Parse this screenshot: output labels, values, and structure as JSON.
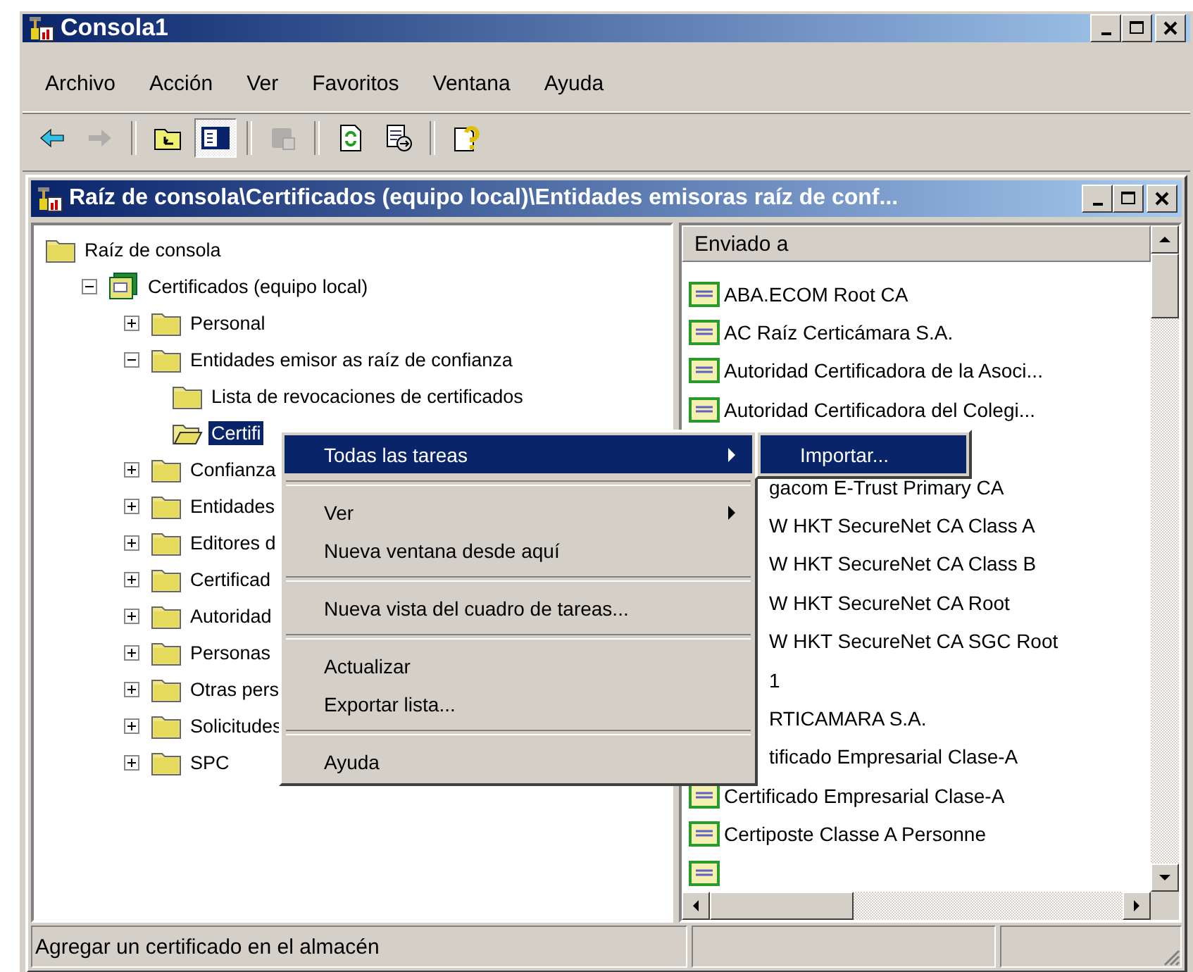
{
  "window": {
    "title": "Consola1"
  },
  "menu_bar": [
    "Archivo",
    "Acción",
    "Ver",
    "Favoritos",
    "Ventana",
    "Ayuda"
  ],
  "toolbar": [
    {
      "kind": "back",
      "pressed": false,
      "disabled": false
    },
    {
      "kind": "forward",
      "pressed": false,
      "disabled": true
    },
    {
      "kind": "sep"
    },
    {
      "kind": "up-folder",
      "pressed": false,
      "disabled": false
    },
    {
      "kind": "tree-toggle",
      "pressed": true,
      "disabled": false
    },
    {
      "kind": "sep"
    },
    {
      "kind": "new-window",
      "pressed": false,
      "disabled": true
    },
    {
      "kind": "sep"
    },
    {
      "kind": "refresh",
      "pressed": false,
      "disabled": false
    },
    {
      "kind": "export",
      "pressed": false,
      "disabled": false
    },
    {
      "kind": "sep"
    },
    {
      "kind": "help",
      "pressed": false,
      "disabled": false
    }
  ],
  "child_window": {
    "title": "Raíz de consola\\Certificados (equipo local)\\Entidades emisoras raíz de conf..."
  },
  "tree": [
    {
      "label": "Raíz de consola",
      "kind": "folder",
      "selected": false,
      "children": [
        {
          "label": "Certificados (equipo local)",
          "kind": "store",
          "expanded": true,
          "selected": false,
          "children": [
            {
              "label": "Personal",
              "kind": "folder",
              "expanded": false,
              "selected": false
            },
            {
              "label": "Entidades emisor as raíz de confianza",
              "kind": "folder",
              "expanded": true,
              "selected": false,
              "children": [
                {
                  "label": "Lista de revocaciones de certificados",
                  "kind": "folder",
                  "selected": false
                },
                {
                  "label": "Certifi",
                  "kind": "open-folder",
                  "selected": true
                }
              ]
            },
            {
              "label": "Confianza",
              "kind": "folder",
              "expanded": false,
              "selected": false
            },
            {
              "label": "Entidades",
              "kind": "folder",
              "expanded": false,
              "selected": false
            },
            {
              "label": "Editores d",
              "kind": "folder",
              "expanded": false,
              "selected": false
            },
            {
              "label": "Certificad",
              "kind": "folder",
              "expanded": false,
              "selected": false
            },
            {
              "label": "Autoridad",
              "kind": "folder",
              "expanded": false,
              "selected": false
            },
            {
              "label": "Personas",
              "kind": "folder",
              "expanded": false,
              "selected": false
            },
            {
              "label": "Otras pers",
              "kind": "folder",
              "expanded": false,
              "selected": false
            },
            {
              "label": "Solicitudes",
              "kind": "folder",
              "expanded": false,
              "selected": false
            },
            {
              "label": "SPC",
              "kind": "folder",
              "expanded": false,
              "selected": false
            }
          ]
        }
      ]
    }
  ],
  "list": {
    "column": "Enviado a",
    "rows": [
      {
        "text": "ABA.ECOM Root CA",
        "covered": false
      },
      {
        "text": "AC Raíz Certicámara S.A.",
        "covered": false
      },
      {
        "text": "Autoridad Certificadora de la Asoci...",
        "covered": false
      },
      {
        "text": "Autoridad Certificadora del Colegi...",
        "covered": false
      },
      {},
      {
        "text": "gacom E-Trust Primary CA",
        "covered": true
      },
      {
        "text": "W HKT SecureNet CA Class A",
        "covered": true
      },
      {
        "text": "W HKT SecureNet CA Class B",
        "covered": true
      },
      {
        "text": "W HKT SecureNet CA Root",
        "covered": true
      },
      {
        "text": "W HKT SecureNet CA SGC Root",
        "covered": true
      },
      {
        "text": "1",
        "covered": true
      },
      {
        "text": "RTICAMARA S.A.",
        "covered": true
      },
      {
        "text": "tificado Empresarial Clase-A",
        "covered": true
      },
      {
        "text": "Certificado Empresarial Clase-A",
        "covered": false
      },
      {
        "text": "Certiposte Classe A Personne",
        "covered": false
      },
      {
        "covered": false
      }
    ]
  },
  "context_menu": [
    {
      "kind": "item",
      "label": "Todas las tareas",
      "submenu": true,
      "selected": true
    },
    {
      "kind": "separator"
    },
    {
      "kind": "item",
      "label": "Ver",
      "submenu": true,
      "selected": false
    },
    {
      "kind": "item",
      "label": "Nueva ventana desde aquí",
      "submenu": false,
      "selected": false
    },
    {
      "kind": "separator"
    },
    {
      "kind": "item",
      "label": "Nueva vista del cuadro de tareas...",
      "submenu": false,
      "selected": false
    },
    {
      "kind": "separator"
    },
    {
      "kind": "item",
      "label": "Actualizar",
      "submenu": false,
      "selected": false
    },
    {
      "kind": "item",
      "label": "Exportar lista...",
      "submenu": false,
      "selected": false
    },
    {
      "kind": "separator"
    },
    {
      "kind": "item",
      "label": "Ayuda",
      "submenu": false,
      "selected": false
    }
  ],
  "submenu": [
    {
      "label": "Importar...",
      "selected": true
    }
  ],
  "status_bar": {
    "text": "Agregar un certificado en el almacén"
  }
}
